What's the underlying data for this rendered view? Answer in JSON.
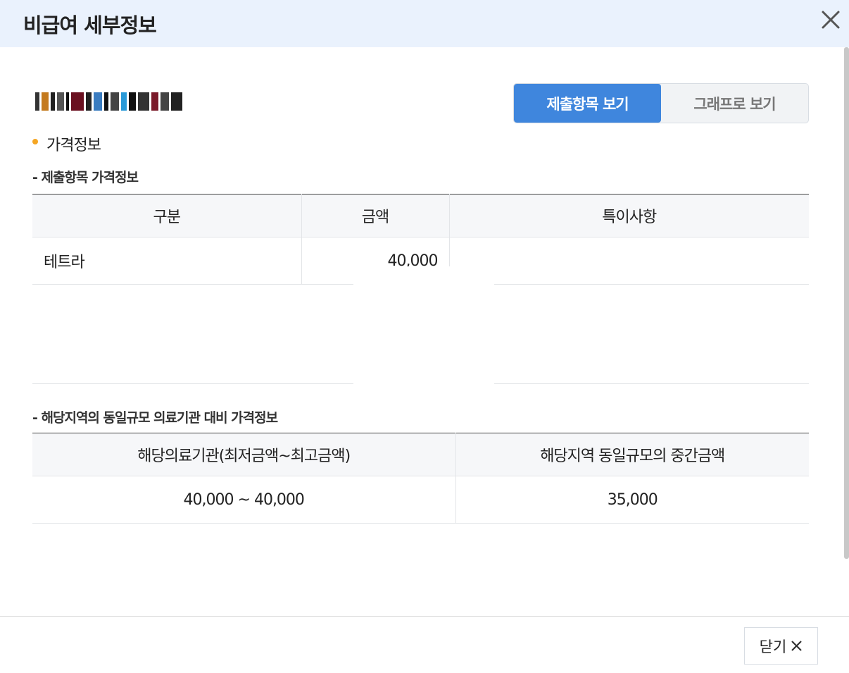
{
  "header": {
    "title": "비급여 세부정보"
  },
  "toggle": {
    "submitted_label": "제출항목 보기",
    "graph_label": "그래프로 보기"
  },
  "section": {
    "title": "가격정보"
  },
  "submitted": {
    "subtitle": "- 제출항목 가격정보",
    "columns": [
      "구분",
      "금액",
      "특이사항"
    ],
    "rows": [
      {
        "category": "테트라",
        "amount": "40,000",
        "note": ""
      }
    ]
  },
  "comparison": {
    "subtitle": "- 해당지역의 동일규모 의료기관 대비 가격정보",
    "columns": [
      "해당의료기관(최저금액~최고금액)",
      "해당지역 동일규모의 중간금액"
    ],
    "rows": [
      {
        "range": "40,000 ~ 40,000",
        "median": "35,000"
      }
    ]
  },
  "footer": {
    "close_label": "닫기"
  },
  "colors": {
    "accent": "#3f86dd",
    "bullet": "#f5a623",
    "header_bg": "#eaf2fd"
  },
  "icons": {
    "close": "close-icon"
  }
}
